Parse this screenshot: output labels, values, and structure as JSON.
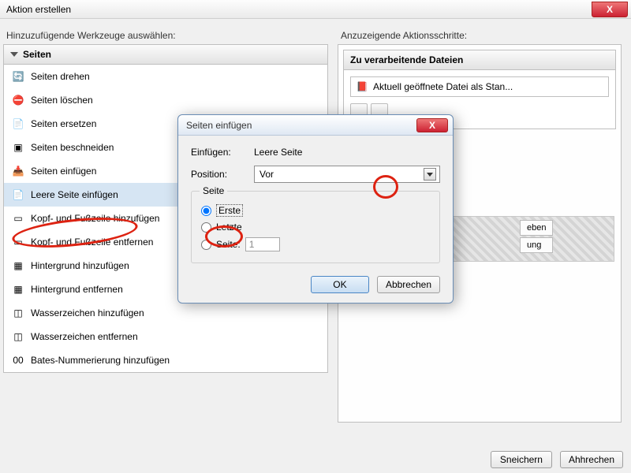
{
  "window": {
    "title": "Aktion erstellen",
    "close_x": "X"
  },
  "left": {
    "label": "Hinzuzufügende Werkzeuge auswählen:",
    "group": "Seiten",
    "items": [
      "Seiten drehen",
      "Seiten löschen",
      "Seiten ersetzen",
      "Seiten beschneiden",
      "Seiten einfügen",
      "Leere Seite einfügen",
      "Kopf- und Fußzeile hinzufügen",
      "Kopf- und Fußzeile entfernen",
      "Hintergrund hinzufügen",
      "Hintergrund entfernen",
      "Wasserzeichen hinzufügen",
      "Wasserzeichen entfernen",
      "Bates-Nummerierung hinzufügen"
    ]
  },
  "right": {
    "label": "Anzuzeigende Aktionsschritte:",
    "box_title": "Zu verarbeitende Dateien",
    "file_row": "Aktuell geöffnete Datei als Stan...",
    "frag1": "eben",
    "frag2": "ung"
  },
  "dialog": {
    "title": "Seiten einfügen",
    "insert_label": "Einfügen:",
    "insert_value": "Leere Seite",
    "position_label": "Position:",
    "position_value": "Vor",
    "group": "Seite",
    "r_first": "Erste",
    "r_last": "Letzte",
    "r_page": "Seite:",
    "page_num": "1",
    "ok": "OK",
    "cancel": "Abbrechen"
  },
  "footer": {
    "save": "Sneichern",
    "cancel": "Ahhrechen"
  },
  "sidebtn_glyphs": {
    "add1": "+",
    "add2": "+",
    "wrench": "≡",
    "up": "▲",
    "down": "▼",
    "trash": "🗑"
  }
}
